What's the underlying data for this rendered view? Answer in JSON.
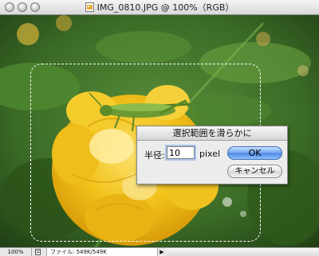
{
  "window": {
    "title": "IMG_0810.JPG @ 100%（RGB）",
    "document_icon": "jpeg-document-icon"
  },
  "dialog": {
    "title": "選択範囲を滑らかに",
    "radius_label": "半径:",
    "radius_value": "10",
    "unit": "pixel",
    "ok_label": "OK",
    "cancel_label": "キャンセル"
  },
  "statusbar": {
    "zoom": "100%",
    "file_info": "ファイル: 549K/549K",
    "menu_arrow": "▶"
  },
  "colors": {
    "ok_button": "#5c97ea",
    "flower": "#f2c21a",
    "grasshopper": "#6c9a33",
    "foliage": "#3f7a2a"
  }
}
